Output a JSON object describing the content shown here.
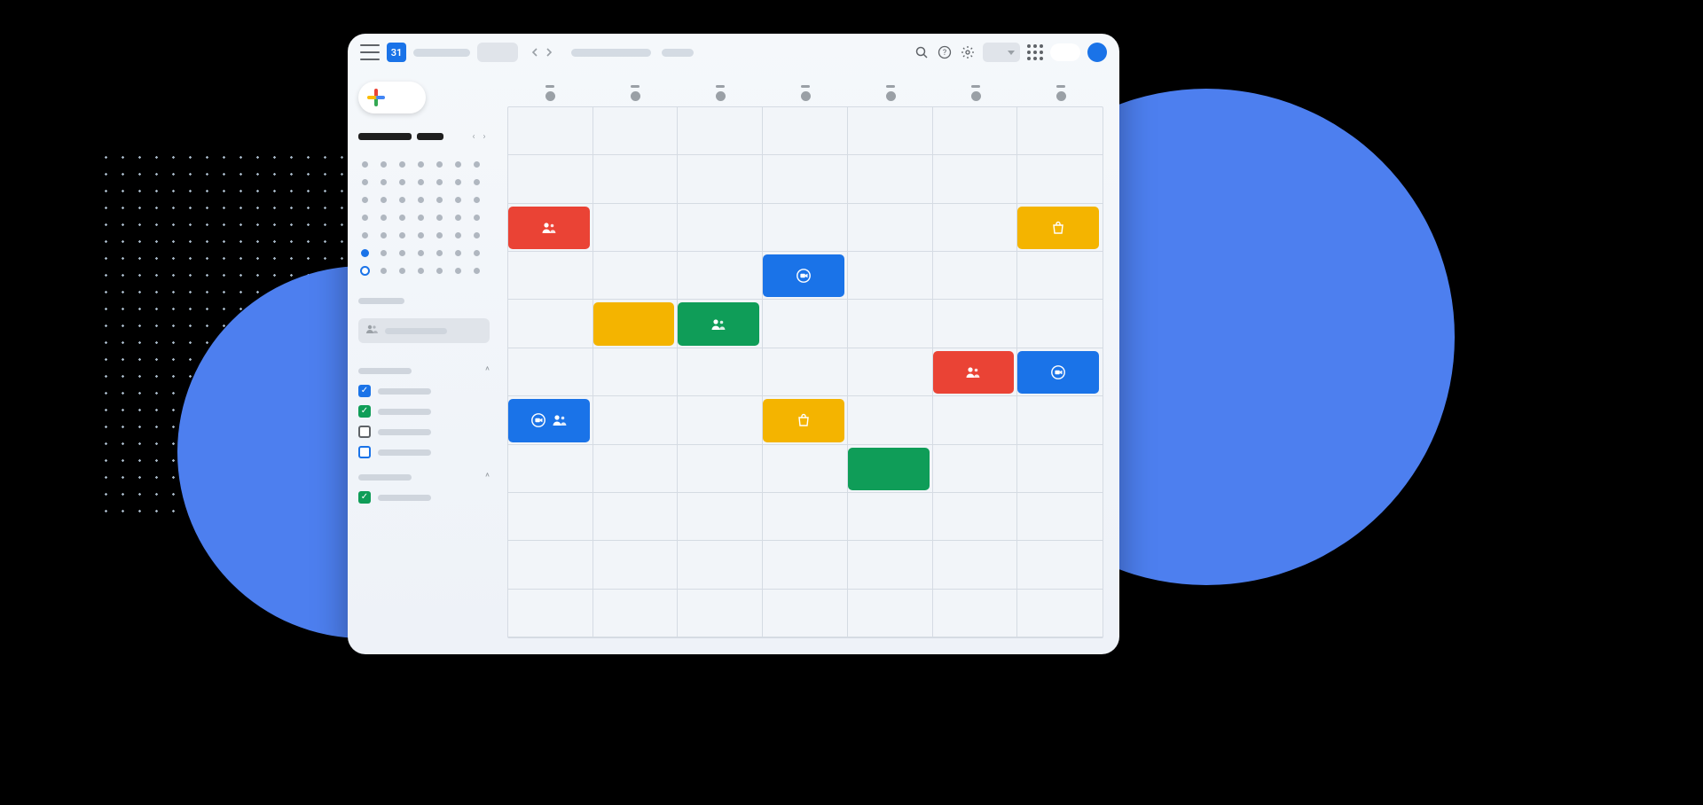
{
  "app": {
    "logo_day": "31"
  },
  "colors": {
    "blue": "#1a73e8",
    "red": "#ea4335",
    "yellow": "#f4b400",
    "green": "#0f9d58"
  },
  "mini_calendar": {
    "rows": 7,
    "cols": 7,
    "current_cell": 35,
    "today_cell": 42
  },
  "calendar_groups": [
    {
      "id": "my-calendars",
      "items": [
        {
          "checked": true,
          "color": "#1a73e8"
        },
        {
          "checked": true,
          "color": "#0f9d58"
        },
        {
          "checked": false,
          "color": "#5f6368"
        },
        {
          "checked": false,
          "color": "#1a73e8"
        }
      ]
    },
    {
      "id": "other-calendars",
      "items": [
        {
          "checked": true,
          "color": "#0f9d58"
        }
      ]
    }
  ],
  "grid": {
    "cols": 7,
    "rows": 11
  },
  "events": [
    {
      "color": "red",
      "row": 2,
      "col": 0,
      "span": 1,
      "icons": [
        "people"
      ]
    },
    {
      "color": "yellow",
      "row": 2,
      "col": 6,
      "span": 1,
      "icons": [
        "bag"
      ]
    },
    {
      "color": "blue",
      "row": 3,
      "col": 3,
      "span": 1,
      "icons": [
        "video-chat"
      ]
    },
    {
      "color": "yellow",
      "row": 4,
      "col": 1,
      "span": 1,
      "icons": []
    },
    {
      "color": "green",
      "row": 4,
      "col": 2,
      "span": 1,
      "icons": [
        "people"
      ]
    },
    {
      "color": "red",
      "row": 5,
      "col": 5,
      "span": 1,
      "icons": [
        "people"
      ]
    },
    {
      "color": "blue",
      "row": 5,
      "col": 6,
      "span": 1,
      "icons": [
        "video-chat"
      ]
    },
    {
      "color": "blue",
      "row": 6,
      "col": 0,
      "span": 1,
      "icons": [
        "video-chat",
        "people"
      ]
    },
    {
      "color": "yellow",
      "row": 6,
      "col": 3,
      "span": 1,
      "icons": [
        "bag"
      ]
    },
    {
      "color": "green",
      "row": 7,
      "col": 4,
      "span": 1,
      "icons": []
    }
  ]
}
